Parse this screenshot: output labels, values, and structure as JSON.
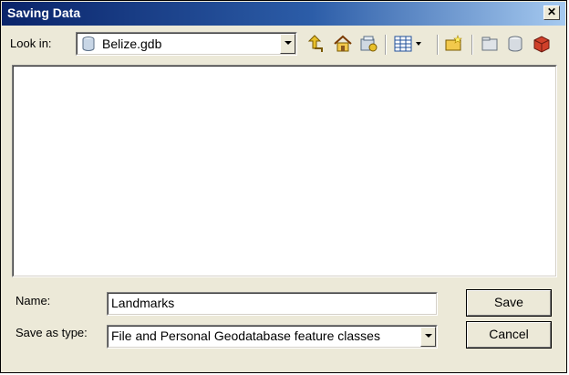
{
  "window": {
    "title": "Saving Data",
    "close_glyph": "✕"
  },
  "lookin": {
    "label": "Look in:",
    "value": "Belize.gdb",
    "icon": "geodatabase-icon"
  },
  "toolbar": {
    "icons": [
      "up-one-level-icon",
      "home-icon",
      "connect-folder-icon",
      "view-menu-icon",
      "new-folder-icon",
      "new-file-geodatabase-icon",
      "new-personal-geodatabase-icon",
      "new-enterprise-geodatabase-icon"
    ]
  },
  "form": {
    "name_label": "Name:",
    "name_value": "Landmarks",
    "type_label": "Save as type:",
    "type_value": "File and Personal Geodatabase feature classes"
  },
  "buttons": {
    "save": "Save",
    "cancel": "Cancel"
  }
}
